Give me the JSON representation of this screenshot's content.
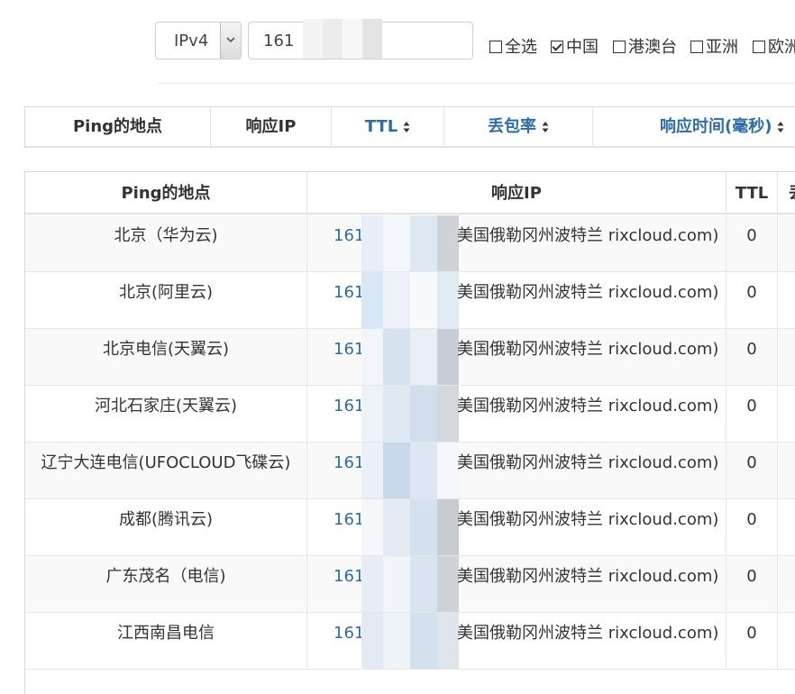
{
  "toolbar": {
    "ip_version": "IPv4",
    "ip_value": "161",
    "checkboxes": [
      {
        "label": "全选",
        "checked": false
      },
      {
        "label": "中国",
        "checked": true
      },
      {
        "label": "港澳台",
        "checked": false
      },
      {
        "label": "亚洲",
        "checked": false
      },
      {
        "label": "欧洲",
        "checked": false
      }
    ]
  },
  "sort_header": {
    "columns": [
      {
        "label": "Ping的地点",
        "sortable": false
      },
      {
        "label": "响应IP",
        "sortable": false
      },
      {
        "label": "TTL",
        "sortable": true
      },
      {
        "label": "丢包率",
        "sortable": true
      },
      {
        "label": "响应时间(毫秒)",
        "sortable": true
      }
    ]
  },
  "table": {
    "columns": [
      "Ping的地点",
      "响应IP",
      "TTL",
      "丢"
    ],
    "rows": [
      {
        "location": "北京（华为云)",
        "ip_prefix": "161",
        "ip_suffix": "美国俄勒冈州波特兰 rixcloud.com)",
        "ttl": "0"
      },
      {
        "location": "北京(阿里云)",
        "ip_prefix": "161",
        "ip_suffix": "美国俄勒冈州波特兰 rixcloud.com)",
        "ttl": "0"
      },
      {
        "location": "北京电信(天翼云)",
        "ip_prefix": "161",
        "ip_suffix": "美国俄勒冈州波特兰 rixcloud.com)",
        "ttl": "0"
      },
      {
        "location": "河北石家庄(天翼云)",
        "ip_prefix": "161",
        "ip_suffix": "美国俄勒冈州波特兰 rixcloud.com)",
        "ttl": "0"
      },
      {
        "location": "辽宁大连电信(UFOCLOUD飞碟云)",
        "ip_prefix": "161",
        "ip_suffix": "美国俄勒冈州波特兰 rixcloud.com)",
        "ttl": "0"
      },
      {
        "location": "成都(腾讯云)",
        "ip_prefix": "161",
        "ip_suffix": "美国俄勒冈州波特兰 rixcloud.com)",
        "ttl": "0"
      },
      {
        "location": "广东茂名（电信)",
        "ip_prefix": "161",
        "ip_suffix": "美国俄勒冈州波特兰 rixcloud.com)",
        "ttl": "0"
      },
      {
        "location": "江西南昌电信",
        "ip_prefix": "161",
        "ip_suffix": "美国俄勒冈州波特兰 rixcloud.com)",
        "ttl": "0"
      }
    ]
  },
  "colors": {
    "link": "#2e6da4",
    "border": "#e3e3e3",
    "stripe": "#f9f9f9"
  }
}
